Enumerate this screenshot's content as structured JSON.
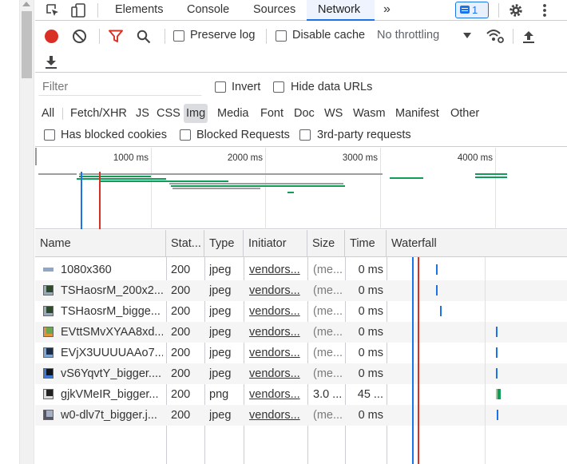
{
  "tabs": [
    "Elements",
    "Console",
    "Sources",
    "Network"
  ],
  "active_tab": "Network",
  "more_tabs": "»",
  "issues_count": "1",
  "toolbar": {
    "preserve_log": "Preserve log",
    "disable_cache": "Disable cache",
    "throttling": "No throttling"
  },
  "filter": {
    "placeholder": "Filter",
    "invert": "Invert",
    "hide_data_urls": "Hide data URLs",
    "types": [
      "All",
      "Fetch/XHR",
      "JS",
      "CSS",
      "Img",
      "Media",
      "Font",
      "Doc",
      "WS",
      "Wasm",
      "Manifest",
      "Other"
    ],
    "active_type": "Img",
    "has_blocked_cookies": "Has blocked cookies",
    "blocked_requests": "Blocked Requests",
    "third_party": "3rd-party requests"
  },
  "overview": {
    "ticks": [
      "1000 ms",
      "2000 ms",
      "3000 ms",
      "4000 ms"
    ]
  },
  "table": {
    "headers": [
      "Name",
      "Stat...",
      "Type",
      "Initiator",
      "Size",
      "Time",
      "Waterfall"
    ],
    "rows": [
      {
        "name": "1080x360",
        "status": "200",
        "type": "jpeg",
        "initiator": "vendors...",
        "size": "(me...",
        "time": "0 ms",
        "icon": "image-banner-icon"
      },
      {
        "name": "TSHaosrM_200x2...",
        "status": "200",
        "type": "jpeg",
        "initiator": "vendors...",
        "size": "(me...",
        "time": "0 ms",
        "icon": "image-thumbnail-icon"
      },
      {
        "name": "TSHaosrM_bigge...",
        "status": "200",
        "type": "jpeg",
        "initiator": "vendors...",
        "size": "(me...",
        "time": "0 ms",
        "icon": "image-thumbnail-icon"
      },
      {
        "name": "EVttSMvXYAA8xd...",
        "status": "200",
        "type": "jpeg",
        "initiator": "vendors...",
        "size": "(me...",
        "time": "0 ms",
        "icon": "image-thumbnail-icon"
      },
      {
        "name": "EVjX3UUUUAAo7...",
        "status": "200",
        "type": "jpeg",
        "initiator": "vendors...",
        "size": "(me...",
        "time": "0 ms",
        "icon": "image-thumbnail-icon"
      },
      {
        "name": "vS6YqvtY_bigger....",
        "status": "200",
        "type": "jpeg",
        "initiator": "vendors...",
        "size": "(me...",
        "time": "0 ms",
        "icon": "image-thumbnail-icon"
      },
      {
        "name": "gjkVMeIR_bigger...",
        "status": "200",
        "type": "png",
        "initiator": "vendors...",
        "size": "3.0 ...",
        "time": "45 ...",
        "icon": "image-thumbnail-icon"
      },
      {
        "name": "w0-dlv7t_bigger.j...",
        "status": "200",
        "type": "jpeg",
        "initiator": "vendors...",
        "size": "(me...",
        "time": "0 ms",
        "icon": "image-thumbnail-icon"
      }
    ]
  },
  "colors": {
    "accent": "#1a73e8",
    "record": "#d93025",
    "overview_green": "#0f9d58",
    "overview_gray": "#9e9e9e"
  }
}
